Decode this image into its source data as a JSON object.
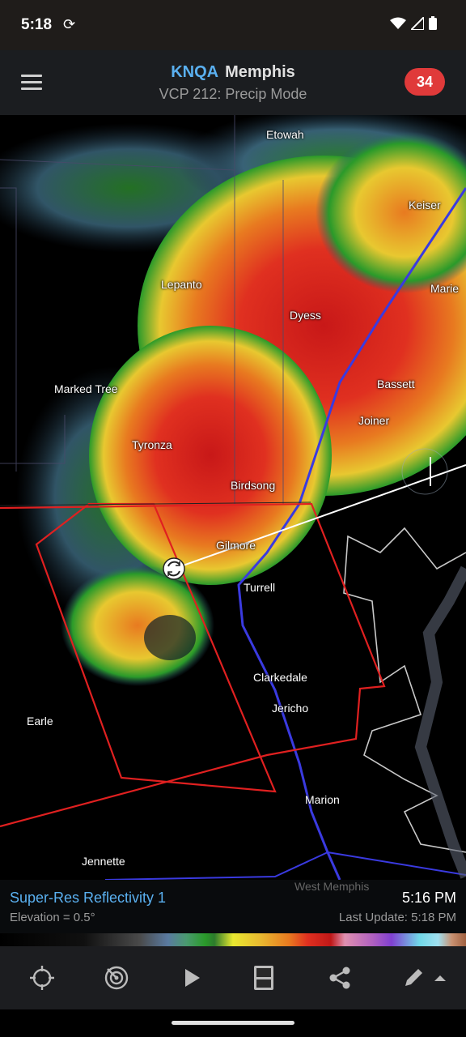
{
  "status": {
    "time": "5:18"
  },
  "header": {
    "station": "KNQA",
    "city": "Memphis",
    "subtitle": "VCP 212: Precip Mode",
    "alert_count": "34"
  },
  "map": {
    "labels": [
      "Etowah",
      "Keiser",
      "Lepanto",
      "Marie",
      "Dyess",
      "Marked Tree",
      "Bassett",
      "Joiner",
      "Tyronza",
      "Birdsong",
      "Gilmore",
      "Turrell",
      "Clarkedale",
      "Jericho",
      "Earle",
      "Marion",
      "Jennette",
      "West Memphis"
    ]
  },
  "info": {
    "product": "Super-Res Reflectivity 1",
    "elevation": "Elevation = 0.5°",
    "scan_time": "5:16 PM",
    "last_update": "Last Update: 5:18 PM"
  },
  "icons": {
    "location": "crosshair-icon",
    "radar": "radar-icon",
    "play": "play-icon",
    "layers": "layers-icon",
    "share": "share-icon",
    "draw": "pencil-icon"
  }
}
